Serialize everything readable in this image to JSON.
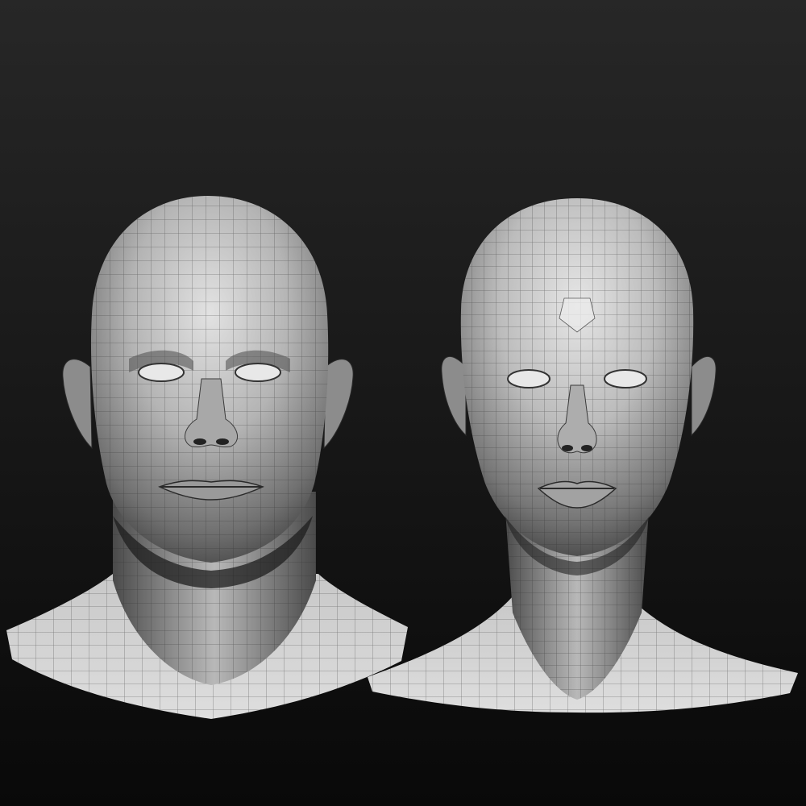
{
  "scene": {
    "background": {
      "top": "#262626",
      "bottom": "#0a0a0a"
    },
    "mesh_color": "#3a3a3a",
    "skin_light": "#e6e6e6",
    "skin_mid": "#9a9a9a",
    "skin_dark": "#3c3c3c",
    "models": [
      {
        "name": "male-head-wireframe",
        "label": ""
      },
      {
        "name": "female-head-wireframe",
        "label": ""
      }
    ]
  }
}
